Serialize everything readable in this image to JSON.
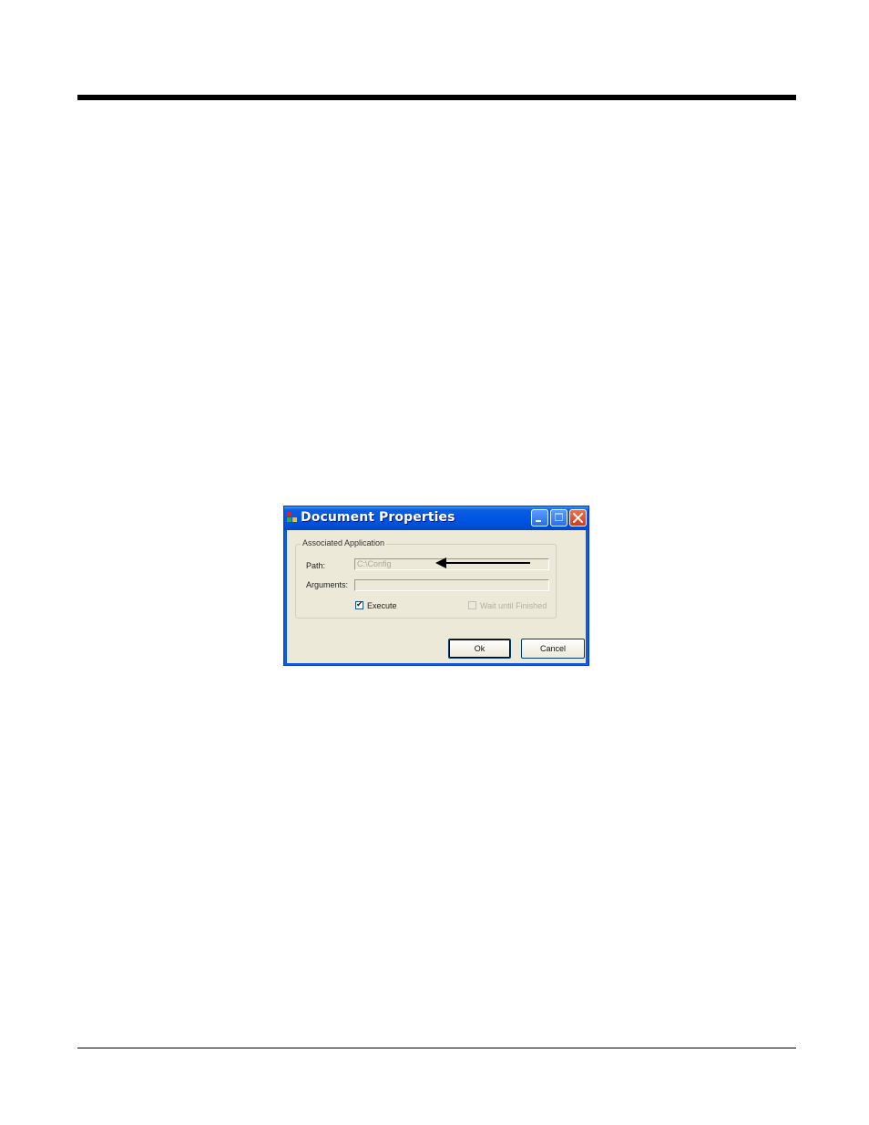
{
  "window": {
    "title": "Document Properties",
    "accent_color": "#0054e3",
    "close_color": "#c4401f",
    "icon": "app-window-icon"
  },
  "dialog": {
    "group_label": "Associated Application",
    "path_label": "Path:",
    "path_value": "C:\\Config",
    "arguments_label": "Arguments:",
    "arguments_value": "",
    "execute_label": "Execute",
    "execute_checked": true,
    "wait_label": "Wait until Finished",
    "wait_checked": false,
    "wait_enabled": false,
    "ok_label": "Ok",
    "cancel_label": "Cancel"
  },
  "annotation": {
    "icon": "arrow-left-icon"
  }
}
